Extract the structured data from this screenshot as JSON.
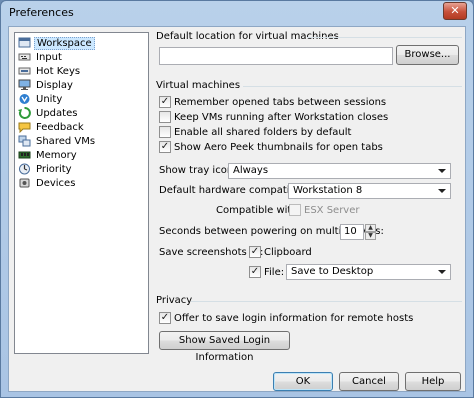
{
  "window": {
    "title": "Preferences",
    "close_label": "✕"
  },
  "sidebar": {
    "items": [
      {
        "label": "Workspace",
        "icon": "workspace-icon",
        "selected": true
      },
      {
        "label": "Input",
        "icon": "input-icon"
      },
      {
        "label": "Hot Keys",
        "icon": "hot-keys-icon"
      },
      {
        "label": "Display",
        "icon": "display-icon"
      },
      {
        "label": "Unity",
        "icon": "unity-icon"
      },
      {
        "label": "Updates",
        "icon": "updates-icon"
      },
      {
        "label": "Feedback",
        "icon": "feedback-icon"
      },
      {
        "label": "Shared VMs",
        "icon": "shared-vms-icon"
      },
      {
        "label": "Memory",
        "icon": "memory-icon"
      },
      {
        "label": "Priority",
        "icon": "priority-icon"
      },
      {
        "label": "Devices",
        "icon": "devices-icon"
      }
    ]
  },
  "default_location": {
    "heading": "Default location for virtual machines",
    "path_value": "",
    "browse_label": "Browse..."
  },
  "vm": {
    "heading": "Virtual machines",
    "checks": [
      {
        "label": "Remember opened tabs between sessions",
        "checked": true
      },
      {
        "label": "Keep VMs running after Workstation closes",
        "checked": false
      },
      {
        "label": "Enable all shared folders by default",
        "checked": false
      },
      {
        "label": "Show Aero Peek thumbnails for open tabs",
        "checked": true
      }
    ],
    "tray_label": "Show tray icon:",
    "tray_value": "Always",
    "hw_label": "Default hardware compatibility:",
    "hw_value": "Workstation 8",
    "compat_label": "Compatible with:",
    "compat_value": "ESX Server",
    "seconds_label": "Seconds between powering on multiple VMs:",
    "seconds_value": "10",
    "screens_label": "Save screenshots to:",
    "clipboard_label": "Clipboard",
    "clipboard_checked": true,
    "file_label": "File:",
    "file_checked": true,
    "file_value": "Save to Desktop"
  },
  "privacy": {
    "heading": "Privacy",
    "offer_label": "Offer to save login information for remote hosts",
    "offer_checked": true,
    "show_saved_label": "Show Saved Login Information"
  },
  "footer": {
    "ok_label": "OK",
    "cancel_label": "Cancel",
    "help_label": "Help"
  },
  "colors": {
    "selection": "#cce8ff",
    "title_bar": "#b9d1ea",
    "close": "#c7503a"
  }
}
